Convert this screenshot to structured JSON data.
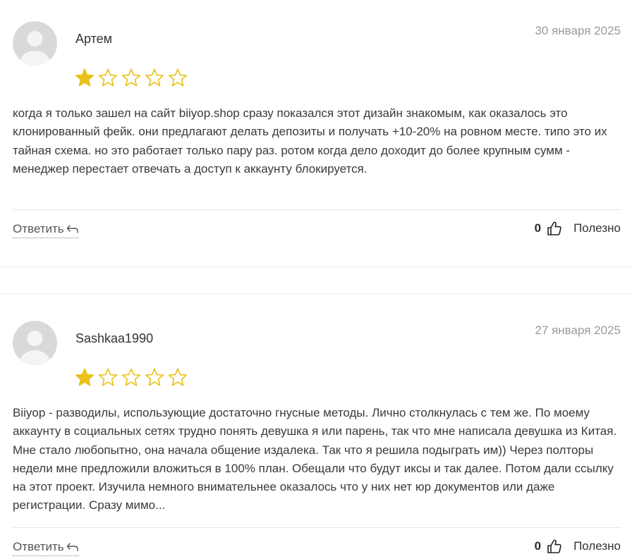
{
  "reviews": [
    {
      "author": "Артем",
      "date": "30 января 2025",
      "rating": 1,
      "max_rating": 5,
      "text": "когда я только зашел на сайт biiyop.shop сразу показался этот дизайн знакомым, как оказалось это клонированный фейк. они предлагают делать депозиты и получать +10-20% на ровном месте. типо это их тайная схема. но это работает только пару раз. ротом когда дело доходит до более крупным сумм - менеджер перестает отвечать а доступ к аккаунту блокируется.",
      "reply_label": "Ответить",
      "useful_count": "0",
      "useful_label": "Полезно"
    },
    {
      "author": "Sashkaa1990",
      "date": "27 января 2025",
      "rating": 1,
      "max_rating": 5,
      "text": "Biiyop - разводилы, использующие достаточно гнусные методы. Лично столкнулась с тем же. По моему аккаунту в социальных сетях трудно понять девушка я или парень, так что мне написала девушка из Китая. Мне стало любопытно, она начала общение издалека. Так что я решила подыграть им)) Через полторы недели мне предложили вложиться в 100% план. Обещали что будут иксы и так далее. Потом дали ссылку на этот проект. Изучила немного внимательнее оказалось что у них нет юр документов или даже регистрации. Сразу мимо...",
      "reply_label": "Ответить",
      "useful_count": "0",
      "useful_label": "Полезно"
    }
  ],
  "colors": {
    "star_filled": "#e8c21a",
    "star_outline": "#e8c21a",
    "avatar_bg": "#d9d9d9",
    "avatar_fg": "#f4f4f4",
    "date": "#9a9a9a",
    "divider": "#e6e6e6"
  },
  "icons": {
    "avatar": "user-silhouette-icon",
    "star": "star-icon",
    "reply": "reply-arrow-icon",
    "useful": "thumbs-up-icon"
  }
}
